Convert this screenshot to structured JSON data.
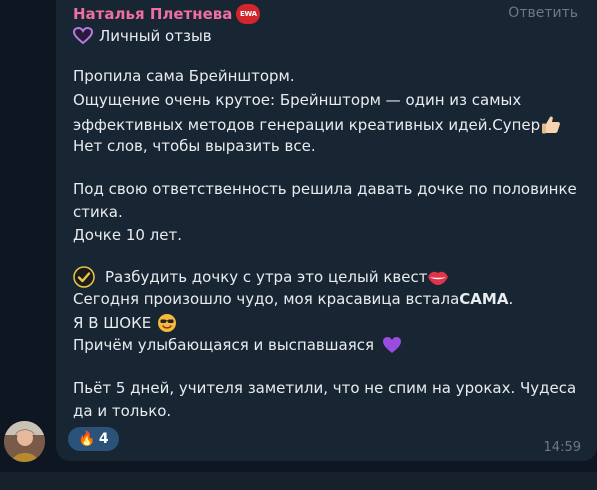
{
  "message": {
    "sender": "Наталья Плетнева",
    "badge": "EWA",
    "reply_label": "Ответить",
    "lines": {
      "l1": "Личный отзыв",
      "l2": "Пропила сама Брейншторм.",
      "l3": "Ощущение очень крутое: Брейншторм — один из самых",
      "l4": "эффективных методов генерации креативных идей.Супер",
      "l5": "Нет слов, чтобы выразить все.",
      "l6": "Под свою ответственность решила давать дочке по половинке",
      "l7": "стика.",
      "l8": "Дочке 10 лет.",
      "l9": "Разбудить дочку с утра это целый квест",
      "l10_a": "Сегодня произошло чудо, моя красавица встала ",
      "l10_b": "САМА",
      "l10_c": ".",
      "l11": "Я В ШОКЕ",
      "l12": "Причём улыбающаяся и выспавшаяся",
      "l13": "Пьёт 5 дней, учителя заметили, что не спим на уроках. Чудеса",
      "l14": "да и только."
    },
    "reaction": {
      "emoji": "🔥",
      "count": "4"
    },
    "time": "14:59"
  },
  "icons": {
    "heart": "purple-heart-outline-icon",
    "thumbs": "thumbs-up-icon",
    "check": "check-badge-icon",
    "lips": "lips-icon",
    "shock": "sunglasses-smile-icon",
    "purple_heart": "purple-heart-icon"
  },
  "colors": {
    "background": "#0e1621",
    "bubble": "#182533",
    "sender": "#ee6fa2",
    "text": "#e8ecef",
    "muted": "#6d7883",
    "reaction_bg": "#2b5278"
  }
}
